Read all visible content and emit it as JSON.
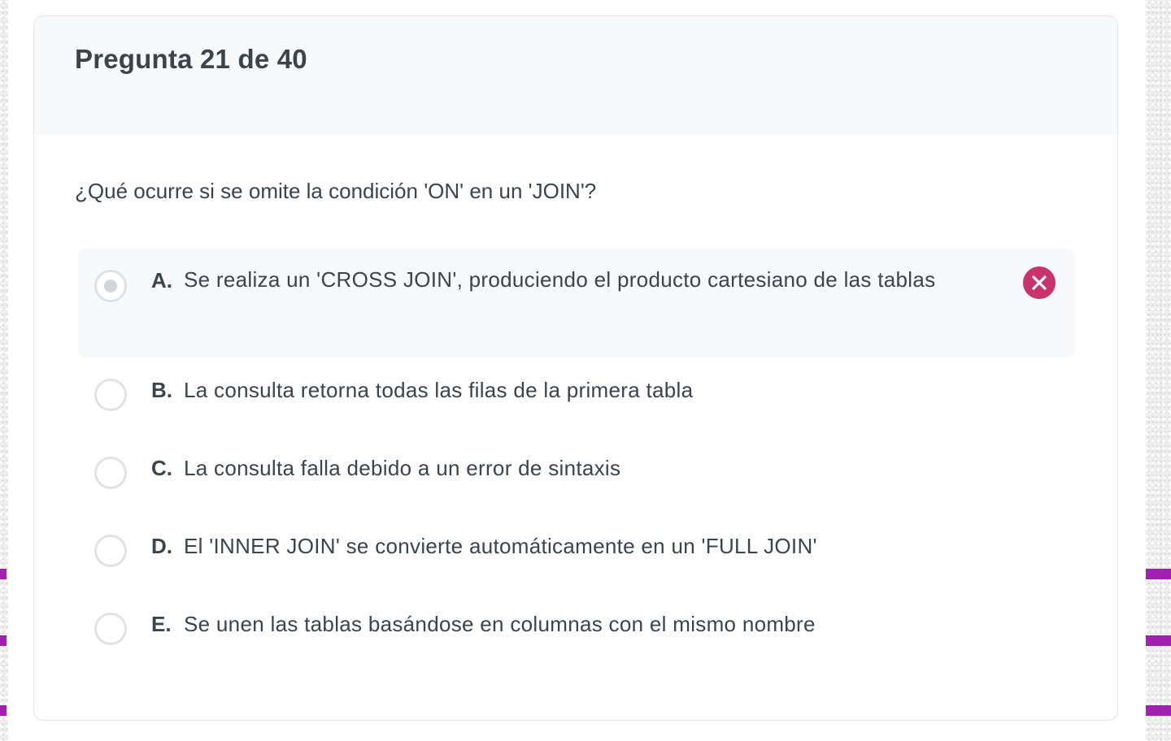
{
  "quiz": {
    "counter": "Pregunta 21 de 40",
    "question": "¿Qué ocurre si se omite la condición 'ON' en un 'JOIN'?",
    "selected_option": "A",
    "options": [
      {
        "letter": "A.",
        "text": "Se realiza un 'CROSS JOIN', produciendo el producto cartesiano de las tablas",
        "selected": true,
        "status": "incorrect"
      },
      {
        "letter": "B.",
        "text": "La consulta retorna todas las filas de la primera tabla",
        "selected": false
      },
      {
        "letter": "C.",
        "text": "La consulta falla debido a un error de sintaxis",
        "selected": false
      },
      {
        "letter": "D.",
        "text": "El 'INNER JOIN' se convierte automáticamente en un 'FULL JOIN'",
        "selected": false
      },
      {
        "letter": "E.",
        "text": "Se unen las tablas basándose en columnas con el mismo nombre",
        "selected": false
      }
    ]
  },
  "icons": {
    "incorrect": "close-circle-icon"
  },
  "colors": {
    "text": "#3c434a",
    "header_bg": "#f8f9fa",
    "incorrect": "#c8336b",
    "radio_border": "#dfe2e6",
    "side_accent": "#a020b0"
  }
}
